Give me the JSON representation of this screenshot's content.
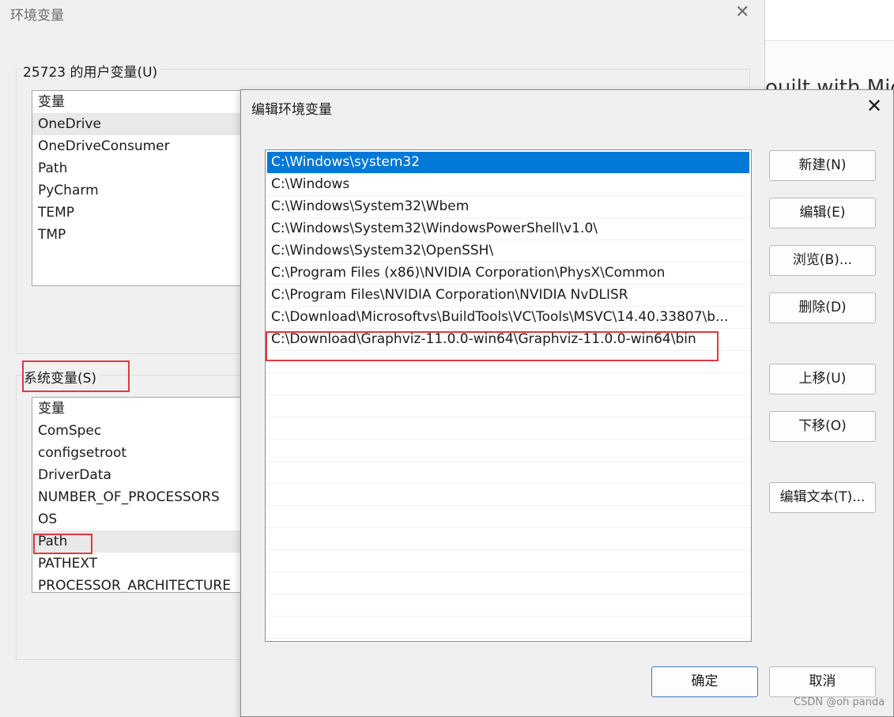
{
  "background_window": {
    "text": "ouilt with Micr"
  },
  "env_dialog": {
    "title": "环境变量",
    "close_glyph": "✕",
    "user_vars": {
      "label": "25723 的用户变量(U)",
      "header": "变量",
      "items": [
        "OneDrive",
        "OneDriveConsumer",
        "Path",
        "PyCharm",
        "TEMP",
        "TMP"
      ],
      "selected_index": 0
    },
    "system_vars": {
      "label": "系统变量(S)",
      "header": "变量",
      "items": [
        "ComSpec",
        "configsetroot",
        "DriverData",
        "NUMBER_OF_PROCESSORS",
        "OS",
        "Path",
        "PATHEXT",
        "PROCESSOR_ARCHITECTURE"
      ],
      "selected_index": 5
    }
  },
  "edit_dialog": {
    "title": "编辑环境变量",
    "close_glyph": "✕",
    "paths": [
      "C:\\Windows\\system32",
      "C:\\Windows",
      "C:\\Windows\\System32\\Wbem",
      "C:\\Windows\\System32\\WindowsPowerShell\\v1.0\\",
      "C:\\Windows\\System32\\OpenSSH\\",
      "C:\\Program Files (x86)\\NVIDIA Corporation\\PhysX\\Common",
      "C:\\Program Files\\NVIDIA Corporation\\NVIDIA NvDLISR",
      "C:\\Download\\Microsoftvs\\BuildTools\\VC\\Tools\\MSVC\\14.40.33807\\b...",
      "C:\\Download\\Graphviz-11.0.0-win64\\Graphviz-11.0.0-win64\\bin"
    ],
    "selected_index": 0,
    "buttons": {
      "new": "新建(N)",
      "edit": "编辑(E)",
      "browse": "浏览(B)...",
      "delete": "删除(D)",
      "move_up": "上移(U)",
      "move_down": "下移(O)",
      "edit_text": "编辑文本(T)...",
      "ok": "确定",
      "cancel": "取消"
    }
  },
  "watermark": "CSDN @oh panda",
  "colors": {
    "selection": "#0078d7",
    "highlight_box": "#e0383e"
  }
}
